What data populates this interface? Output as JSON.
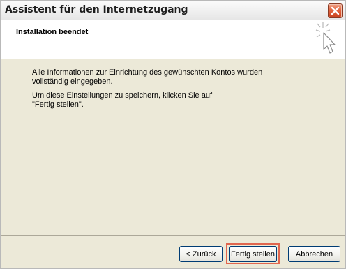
{
  "window": {
    "title": "Assistent für den Internetzugang"
  },
  "header": {
    "title": "Installation beendet"
  },
  "body": {
    "paragraph1": "Alle Informationen zur Einrichtung des gewünschten Kontos wurden vollständig eingegeben.",
    "paragraph2_line1": "Um diese Einstellungen zu speichern, klicken Sie auf",
    "paragraph2_line2": "\"Fertig stellen\"."
  },
  "buttons": {
    "back": "< Zurück",
    "finish": "Fertig stellen",
    "cancel": "Abbrechen"
  },
  "colors": {
    "dialog_background": "#ece9d8",
    "close_button": "#d9512f",
    "highlight_outline": "#e0664f",
    "button_border": "#003c74"
  },
  "icons": {
    "close": "close-icon",
    "wizard": "wizard-cursor-icon"
  }
}
